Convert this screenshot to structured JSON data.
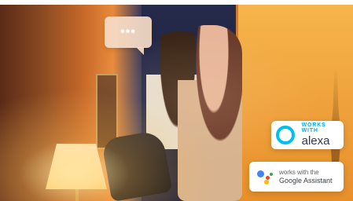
{
  "hero": {
    "chat_bubble": {
      "label": "•••"
    },
    "badges": {
      "alexa": {
        "small": "WORKS WITH",
        "brand": "alexa"
      },
      "google": {
        "small": "works with the",
        "brand": "Google Assistant"
      }
    },
    "colors": {
      "alexa_ring": "#00c0ef",
      "google_blue": "#4285f4",
      "google_red": "#ea4335",
      "google_yellow": "#fbbc05",
      "google_green": "#34a853"
    }
  }
}
